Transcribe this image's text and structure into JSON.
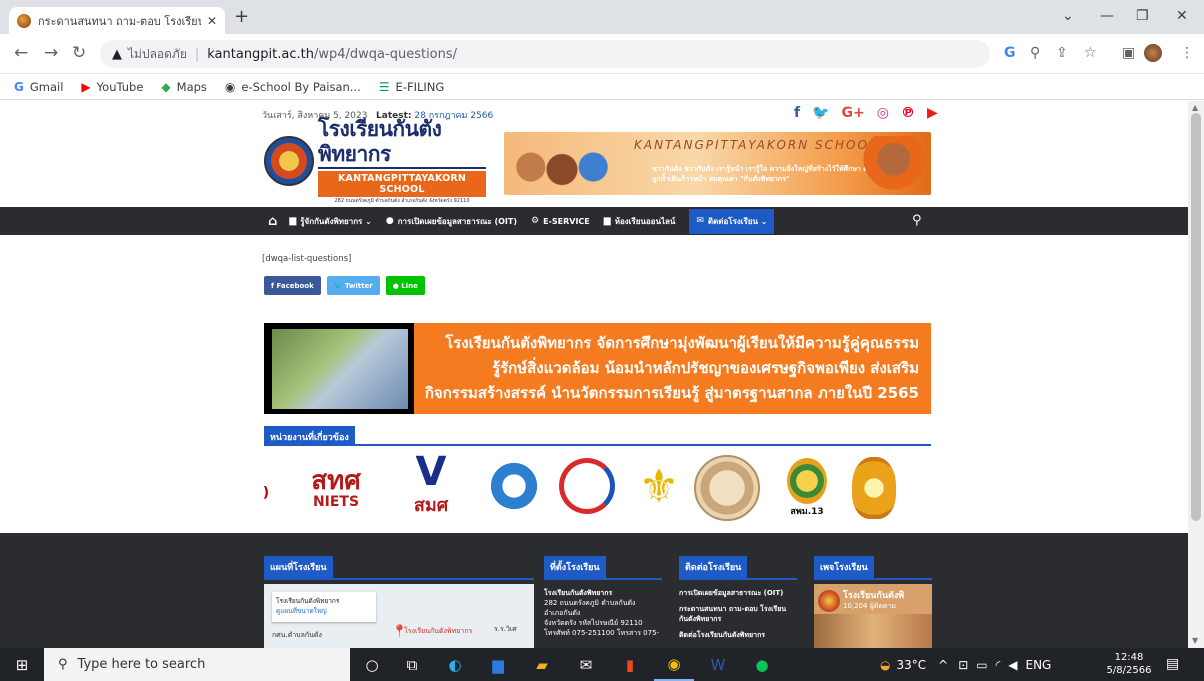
{
  "browser": {
    "tab_title": "กระดานสนทนา ถาม-ตอบ โรงเรียนกันต",
    "tab_close": "✕",
    "new_tab": "+",
    "not_secure": "ไม่ปลอดภัย",
    "url_host": "kantangpit.ac.th",
    "url_path": "/wp4/dwqa-questions/",
    "bookmarks": [
      {
        "icon": "G",
        "label": "Gmail",
        "color": "#4285f4"
      },
      {
        "icon": "▶",
        "label": "YouTube",
        "color": "#ff0000"
      },
      {
        "icon": "◆",
        "label": "Maps",
        "color": "#34a853"
      },
      {
        "icon": "◉",
        "label": "e-School By Paisan...",
        "color": "#3c4043"
      },
      {
        "icon": "☰",
        "label": "E-FILING",
        "color": "#0f9d58"
      }
    ]
  },
  "site": {
    "date": "วันเสาร์, สิงหาคม 5, 2023",
    "latest_label": "Latest:",
    "latest_date": "28 กรกฎาคม 2566",
    "social": [
      {
        "icon": "f",
        "color": "#3b5998"
      },
      {
        "icon": "🐦",
        "color": "#1da1f2"
      },
      {
        "icon": "G+",
        "color": "#dd4b39"
      },
      {
        "icon": "◎",
        "color": "#c13584"
      },
      {
        "icon": "℗",
        "color": "#e60023"
      },
      {
        "icon": "▶",
        "color": "#e62117"
      }
    ],
    "logo_th": "โรงเรียนกันตังพิทยากร",
    "logo_en": "KANTANGPITTAYAKORN SCHOOL",
    "logo_addr": "282 ถนนตรังคภูมิ ตำบลกันตัง อำเภอกันตัง จังหวัดตรัง 92110",
    "banner_title": "KANTANGPITTAYAKORN SCHOOL",
    "banner_motto": "ชาวกันตัง ชาวกันตัง เรารู้หน้า เรารู้ใจ ความยิ่งใหญ่ที่สร้างไว้ให้ศึกษา ดังชีวิตพันพุกของลูกน้ำเดินก้าวหน้า สมคุณค่า \"กันตังพิทยากร\"",
    "nav": {
      "home_icon": "⌂",
      "items": [
        {
          "icon": "▆",
          "label": "รู้จักกันตังพิทยากร ⌄"
        },
        {
          "icon": "●",
          "label": "การเปิดเผยข้อมูลสาธารณะ (OIT)"
        },
        {
          "icon": "⚙",
          "label": "E-SERVICE"
        },
        {
          "icon": "▆",
          "label": "ห้องเรียนออนไลน์"
        }
      ],
      "active": {
        "icon": "✉",
        "label": "ติดต่อโรงเรียน ⌄"
      },
      "search_icon": "⚲"
    },
    "shortcode": "[dwqa-list-questions]",
    "share": [
      {
        "label": "f  Facebook",
        "color": "#3b5998"
      },
      {
        "label": "🐦 Twitter",
        "color": "#55acee"
      },
      {
        "label": "● Line",
        "color": "#00c300"
      }
    ],
    "vision": [
      "โรงเรียนกันตังพิทยากร จัดการศึกษามุ่งพัฒนาผู้เรียนให้มีความรู้คู่คุณธรรม",
      "รู้รักษ์สิ่งแวดล้อม น้อมนำหลักปรัชญาของเศรษฐกิจพอเพียง ส่งเสริม",
      "กิจกรรมสร้างสรรค์ นำนวัตกรรมการเรียนรู้ สู่มาตรฐานสากล ภายในปี 2565"
    ],
    "units_header": "หน่วยงานที่เกี่ยวข้อง",
    "logos": [
      {
        "name": "สทศ",
        "sub": "NIETS"
      },
      {
        "name": "สมศ",
        "sub": ""
      },
      {
        "name": "กรมบัญชีกลาง",
        "sub": ""
      },
      {
        "name": "ศูนย์คุณธรรม",
        "sub": ""
      },
      {
        "name": "ลูกเสือ",
        "sub": ""
      },
      {
        "name": "ตรากระทรวง",
        "sub": ""
      },
      {
        "name": "สพม.13",
        "sub": "สพม.13"
      },
      {
        "name": "ตรากรม",
        "sub": ""
      }
    ],
    "footer": {
      "map_header": "แผนที่โรงเรียน",
      "map_card_title": "โรงเรียนกันตังพิทยากร",
      "map_card_link": "ดูแผนที่ขนาดใหญ่",
      "map_pin_label": "โรงเรียนกันตังพิทยากร",
      "map_place1": "กศน.ตำบลกันตัง",
      "map_place2": "ร.ร.วิเศ",
      "location_header": "ที่ตั้งโรงเรียน",
      "location_lines": [
        "โรงเรียนกันตังพิทยากร",
        "282 ถนนตรังคภูมิ ตำบลกันตัง",
        "อำเภอกันตัง",
        "จังหวัดตรัง รหัสไปรษณีย์ 92110",
        "โทรศัพท์ 075-251100 โทรสาร 075-"
      ],
      "contact_header": "ติดต่อโรงเรียน",
      "contact_lines": [
        "การเปิดเผยข้อมูลสาธารณะ (OIT)",
        "กระดานสนทนา ถาม-ตอบ โรงเรียน",
        "กันตังพิทยากร",
        "ติดต่อโรงเรียนกันตังพิทยากร"
      ],
      "page_header": "เพจโรงเรียน",
      "page_name": "โรงเรียนกันตังพิ",
      "page_likes": "10,204 ผู้ติดตาม"
    }
  },
  "taskbar": {
    "search_placeholder": "Type here to search",
    "temp": "33°C",
    "lang": "ENG",
    "time": "12:48",
    "date": "5/8/2566"
  }
}
